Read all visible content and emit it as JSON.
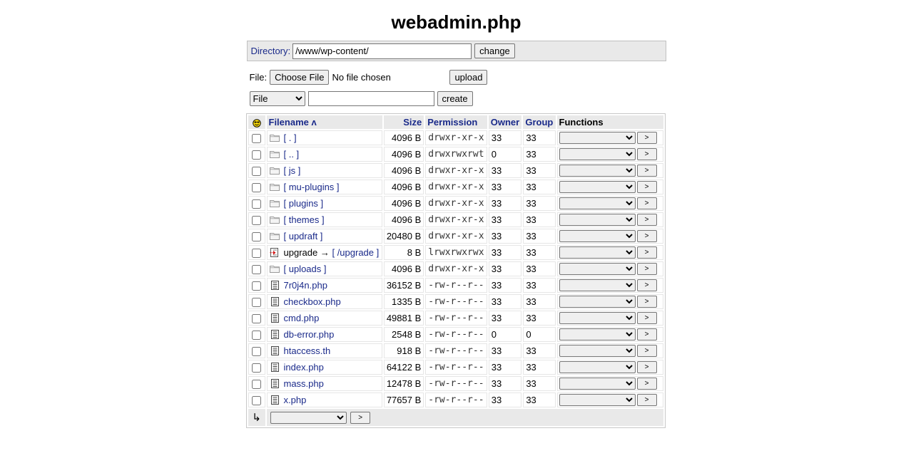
{
  "title": "webadmin.php",
  "directory": {
    "label": "Directory:",
    "value": "/www/wp-content/",
    "change_label": "change"
  },
  "upload": {
    "label": "File:",
    "choose_label": "Choose File",
    "no_file_text": "No file chosen",
    "upload_label": "upload"
  },
  "create": {
    "type_selected": "File",
    "name_value": "",
    "create_label": "create"
  },
  "table": {
    "headers": {
      "filename": "Filename ʌ",
      "size": "Size",
      "permission": "Permission",
      "owner": "Owner",
      "group": "Group",
      "functions": "Functions"
    },
    "rows": [
      {
        "type": "dir",
        "name": "[ . ]",
        "size": "4096 B",
        "perm": "drwxr-xr-x",
        "owner": "33",
        "group": "33"
      },
      {
        "type": "dir",
        "name": "[ .. ]",
        "size": "4096 B",
        "perm": "drwxrwxrwt",
        "owner": "0",
        "group": "33"
      },
      {
        "type": "dir",
        "name": "[ js ]",
        "size": "4096 B",
        "perm": "drwxr-xr-x",
        "owner": "33",
        "group": "33"
      },
      {
        "type": "dir",
        "name": "[ mu-plugins ]",
        "size": "4096 B",
        "perm": "drwxr-xr-x",
        "owner": "33",
        "group": "33"
      },
      {
        "type": "dir",
        "name": "[ plugins ]",
        "size": "4096 B",
        "perm": "drwxr-xr-x",
        "owner": "33",
        "group": "33"
      },
      {
        "type": "dir",
        "name": "[ themes ]",
        "size": "4096 B",
        "perm": "drwxr-xr-x",
        "owner": "33",
        "group": "33"
      },
      {
        "type": "dir",
        "name": "[ updraft ]",
        "size": "20480 B",
        "perm": "drwxr-xr-x",
        "owner": "33",
        "group": "33"
      },
      {
        "type": "link",
        "name": "upgrade",
        "arrow": "→",
        "target": "[ /upgrade ]",
        "size": "8 B",
        "perm": "lrwxrwxrwx",
        "owner": "33",
        "group": "33"
      },
      {
        "type": "dir",
        "name": "[ uploads ]",
        "size": "4096 B",
        "perm": "drwxr-xr-x",
        "owner": "33",
        "group": "33"
      },
      {
        "type": "file",
        "name": "7r0j4n.php",
        "size": "36152 B",
        "perm": "-rw-r--r--",
        "owner": "33",
        "group": "33"
      },
      {
        "type": "file",
        "name": "checkbox.php",
        "size": "1335 B",
        "perm": "-rw-r--r--",
        "owner": "33",
        "group": "33"
      },
      {
        "type": "file",
        "name": "cmd.php",
        "size": "49881 B",
        "perm": "-rw-r--r--",
        "owner": "33",
        "group": "33"
      },
      {
        "type": "file",
        "name": "db-error.php",
        "size": "2548 B",
        "perm": "-rw-r--r--",
        "owner": "0",
        "group": "0"
      },
      {
        "type": "file",
        "name": "htaccess.th",
        "size": "918 B",
        "perm": "-rw-r--r--",
        "owner": "33",
        "group": "33"
      },
      {
        "type": "file",
        "name": "index.php",
        "size": "64122 B",
        "perm": "-rw-r--r--",
        "owner": "33",
        "group": "33"
      },
      {
        "type": "file",
        "name": "mass.php",
        "size": "12478 B",
        "perm": "-rw-r--r--",
        "owner": "33",
        "group": "33"
      },
      {
        "type": "file",
        "name": "x.php",
        "size": "77657 B",
        "perm": "-rw-r--r--",
        "owner": "33",
        "group": "33"
      }
    ],
    "row_go_label": ">",
    "footer": {
      "arrow": "↳",
      "go_label": ">"
    }
  },
  "icons": {
    "folder": "folder-icon",
    "file": "file-icon",
    "link": "link-icon",
    "smiley": "smiley-icon"
  }
}
